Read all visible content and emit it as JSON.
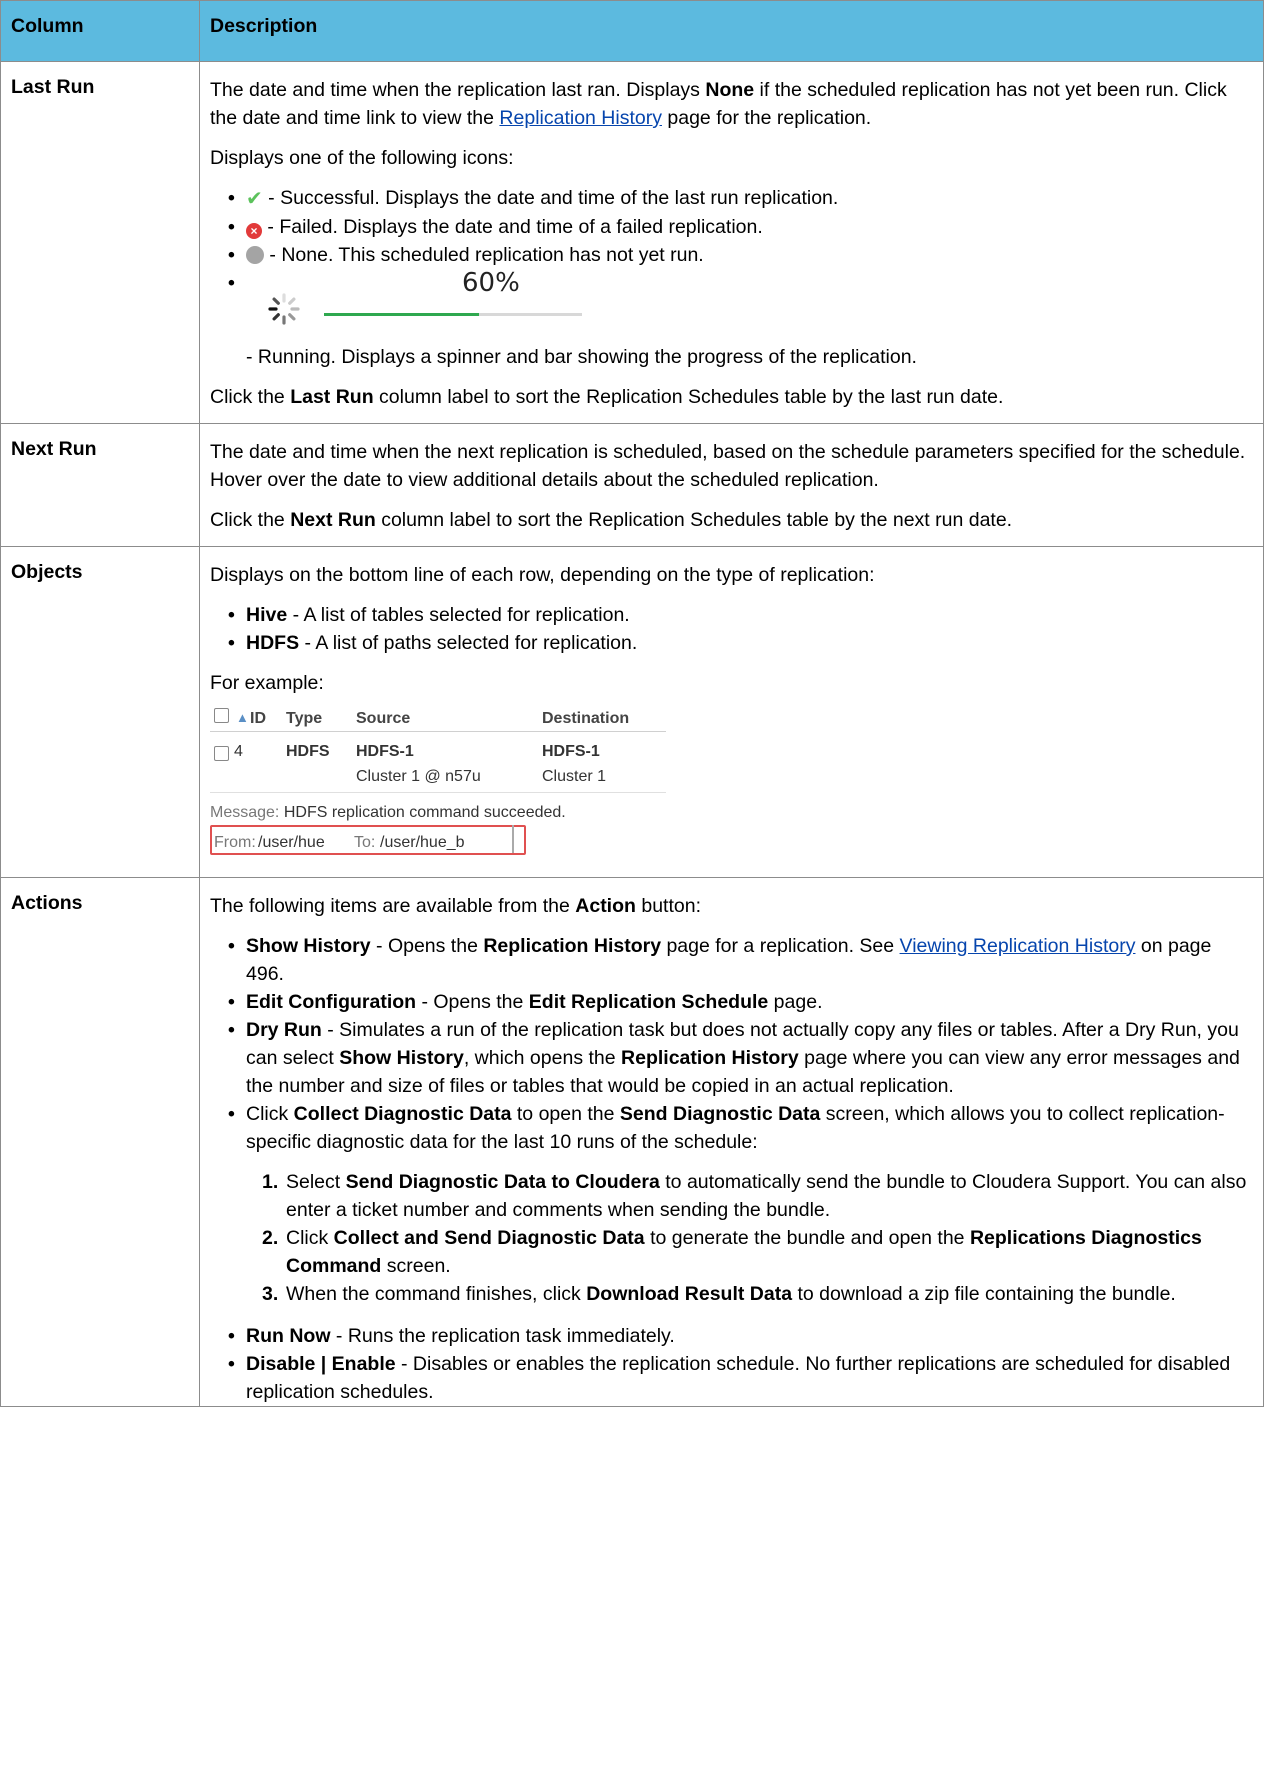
{
  "table": {
    "header": {
      "column": "Column",
      "description": "Description"
    }
  },
  "last_run": {
    "name": "Last Run",
    "p1_a": "The date and time when the replication last ran. Displays ",
    "p1_b": "None",
    "p1_c": " if the scheduled replication has not yet been run. Click the date and time link to view the ",
    "p1_link": "Replication History",
    "p1_d": " page for the replication.",
    "p2": "Displays one of the following icons:",
    "icons": [
      {
        "icon": "check-icon",
        "text": " - Successful. Displays the date and time of the last run replication."
      },
      {
        "icon": "failed-icon",
        "text": " - Failed. Displays the date and time of a failed replication."
      },
      {
        "icon": "none-icon",
        "text": " - None. This scheduled replication has not yet run."
      }
    ],
    "progress": {
      "percent_label": "60%",
      "fraction": 0.6,
      "color": "#2fa84f"
    },
    "running_text": "- Running. Displays a spinner and bar showing the progress of the replication.",
    "p3_a": "Click the ",
    "p3_b": "Last Run",
    "p3_c": " column label to sort the Replication Schedules table by the last run date."
  },
  "next_run": {
    "name": "Next Run",
    "p1": "The date and time when the next replication is scheduled, based on the schedule parameters specified for the schedule. Hover over the date to view additional details about the scheduled replication.",
    "p2_a": "Click the ",
    "p2_b": "Next Run",
    "p2_c": " column label to sort the Replication Schedules table by the next run date."
  },
  "objects": {
    "name": "Objects",
    "p1": "Displays on the bottom line of each row, depending on the type of replication:",
    "items": [
      {
        "b": "Hive",
        "t": " - A list of tables selected for replication."
      },
      {
        "b": "HDFS",
        "t": " - A list of paths selected for replication."
      }
    ],
    "for_example": "For example:",
    "example": {
      "col_id": "ID",
      "col_type": "Type",
      "col_source": "Source",
      "col_destination": "Destination",
      "row_id": "4",
      "row_type": "HDFS",
      "row_source": "HDFS-1",
      "row_source_sub": "Cluster 1 @ n57u",
      "row_dest": "HDFS-1",
      "row_dest_sub": "Cluster 1",
      "message_label": "Message:",
      "message_text": "HDFS replication command succeeded.",
      "from_label": "From:",
      "from_value": "/user/hue",
      "to_label": "To:",
      "to_value": "/user/hue_b"
    }
  },
  "actions": {
    "name": "Actions",
    "p1_a": "The following items are available from the ",
    "p1_b": "Action",
    "p1_c": " button:",
    "show_history": {
      "b": "Show History",
      "t1": " - Opens the ",
      "b2": "Replication History",
      "t2": " page for a replication. See ",
      "link": "Viewing Replication History",
      "t3": " on page 496."
    },
    "edit_config": {
      "b": "Edit Configuration",
      "t1": " - Opens the ",
      "b2": "Edit Replication Schedule",
      "t2": " page."
    },
    "dry_run": {
      "b": "Dry Run",
      "t1": " - Simulates a run of the replication task but does not actually copy any files or tables. After a Dry Run, you can select ",
      "b2": "Show History",
      "t2": ", which opens the ",
      "b3": "Replication History",
      "t3": " page where you can view any error messages and the number and size of files or tables that would be copied in an actual replication."
    },
    "collect": {
      "t1": "Click ",
      "b": "Collect Diagnostic Data",
      "t2": " to open the ",
      "b2": "Send Diagnostic Data",
      "t3": " screen, which allows you to collect replication-specific diagnostic data for the last 10 runs of the schedule:",
      "steps": [
        {
          "n": "1.",
          "t1": "Select ",
          "b": "Send Diagnostic Data to Cloudera",
          "t2": " to automatically send the bundle to Cloudera Support. You can also enter a ticket number and comments when sending the bundle."
        },
        {
          "n": "2.",
          "t1": "Click ",
          "b": "Collect and Send Diagnostic Data",
          "t2": " to generate the bundle and open the ",
          "b2": "Replications Diagnostics Command",
          "t3": " screen."
        },
        {
          "n": "3.",
          "t1": "When the command finishes, click ",
          "b": "Download Result Data",
          "t2": " to download a zip file containing the bundle."
        }
      ]
    },
    "run_now": {
      "b": "Run Now",
      "t": " - Runs the replication task immediately."
    },
    "disable": {
      "b": "Disable | Enable",
      "t": " - Disables or enables the replication schedule. No further replications are scheduled for disabled replication schedules."
    }
  }
}
